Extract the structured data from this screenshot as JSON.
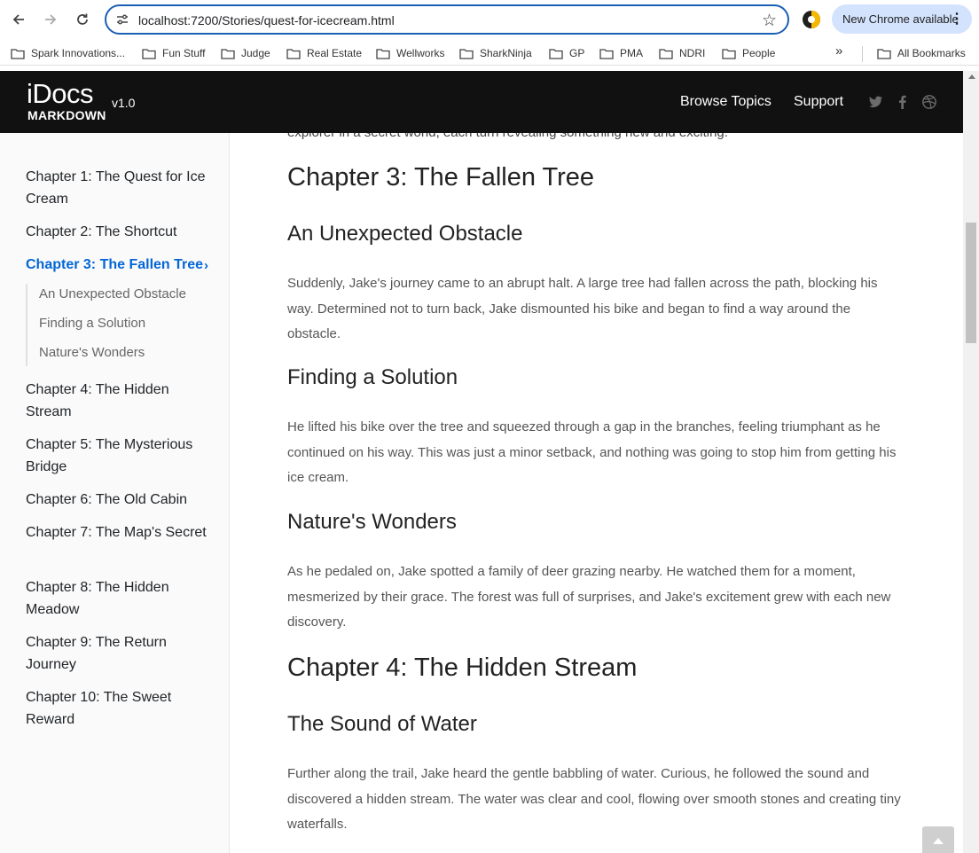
{
  "browser": {
    "url": "localhost:7200/Stories/quest-for-icecream.html",
    "update_label": "New Chrome available",
    "bookmarks": [
      "Spark Innovations...",
      "Fun Stuff",
      "Judge",
      "Real Estate",
      "Wellworks",
      "SharkNinja",
      "GP",
      "PMA",
      "NDRI",
      "People"
    ],
    "all_bookmarks": "All Bookmarks"
  },
  "site": {
    "logo_main": "iDocs",
    "logo_sub": "MARKDOWN",
    "version": "v1.0",
    "nav": [
      "Browse Topics",
      "Support"
    ],
    "social_icons": [
      "twitter-icon",
      "facebook-icon",
      "dribbble-icon"
    ]
  },
  "sidebar": {
    "items": [
      "Chapter 1: The Quest for Ice Cream",
      "Chapter 2: The Shortcut",
      "Chapter 3: The Fallen Tree",
      "Chapter 4: The Hidden Stream",
      "Chapter 5: The Mysterious Bridge",
      "Chapter 6: The Old Cabin",
      "Chapter 7: The Map's Secret",
      "Chapter 8: The Hidden Meadow",
      "Chapter 9: The Return Journey",
      "Chapter 10: The Sweet Reward"
    ],
    "subitems": [
      "An Unexpected Obstacle",
      "Finding a Solution",
      "Nature's Wonders"
    ]
  },
  "content": {
    "cut_line": "explorer in a secret world, each turn revealing something new and exciting.",
    "ch3_title": "Chapter 3: The Fallen Tree",
    "s1_title": "An Unexpected Obstacle",
    "s1_text": "Suddenly, Jake's journey came to an abrupt halt. A large tree had fallen across the path, blocking his way. Determined not to turn back, Jake dismounted his bike and began to find a way around the obstacle.",
    "s2_title": "Finding a Solution",
    "s2_text": "He lifted his bike over the tree and squeezed through a gap in the branches, feeling triumphant as he continued on his way. This was just a minor setback, and nothing was going to stop him from getting his ice cream.",
    "s3_title": "Nature's Wonders",
    "s3_text": "As he pedaled on, Jake spotted a family of deer grazing nearby. He watched them for a moment, mesmerized by their grace. The forest was full of surprises, and Jake's excitement grew with each new discovery.",
    "ch4_title": "Chapter 4: The Hidden Stream",
    "s4_title": "The Sound of Water",
    "s4_text": "Further along the trail, Jake heard the gentle babbling of water. Curious, he followed the sound and discovered a hidden stream. The water was clear and cool, flowing over smooth stones and creating tiny waterfalls."
  }
}
